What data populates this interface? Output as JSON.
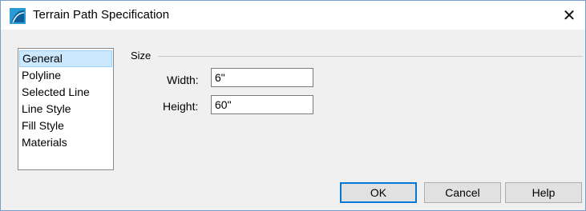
{
  "window": {
    "title": "Terrain Path Specification",
    "close_glyph": "✕"
  },
  "sidebar": {
    "items": [
      {
        "label": "General",
        "selected": true
      },
      {
        "label": "Polyline",
        "selected": false
      },
      {
        "label": "Selected Line",
        "selected": false
      },
      {
        "label": "Line Style",
        "selected": false
      },
      {
        "label": "Fill Style",
        "selected": false
      },
      {
        "label": "Materials",
        "selected": false
      }
    ]
  },
  "size_group": {
    "label": "Size",
    "width_label": "Width:",
    "width_value": "6\"",
    "height_label": "Height:",
    "height_value": "60\""
  },
  "buttons": {
    "ok": "OK",
    "cancel": "Cancel",
    "help": "Help"
  },
  "colors": {
    "selection": "#cce8ff",
    "default_button_border": "#0078d7",
    "icon_accent": "#1e8fd0"
  },
  "icons": {
    "app": "terrain-path-app-icon",
    "close": "close-icon"
  }
}
